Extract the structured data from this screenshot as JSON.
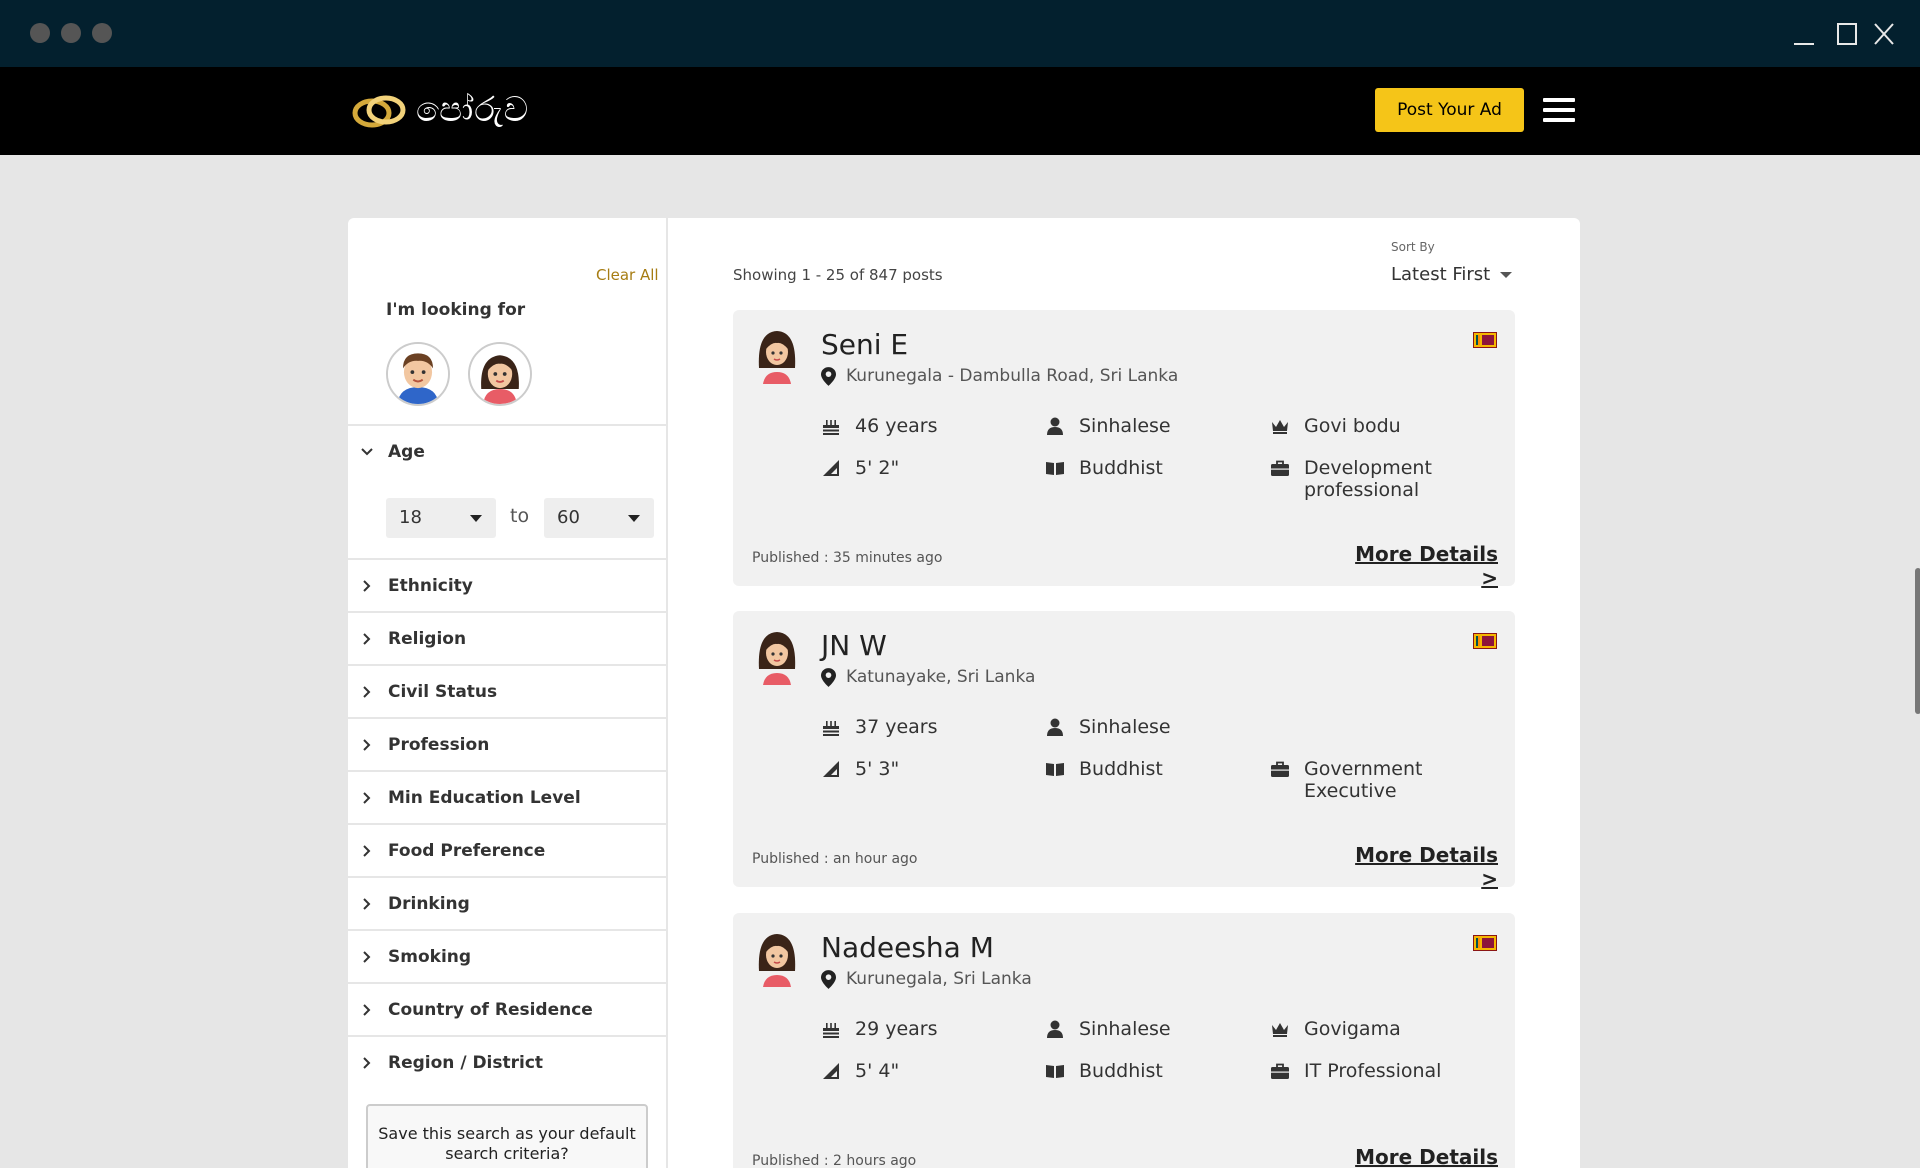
{
  "window": {
    "controls": [
      "minimize-icon",
      "maximize-icon",
      "close-icon"
    ]
  },
  "header": {
    "logo_text": "පෝරුව",
    "post_button": "Post Your Ad",
    "accent": "#f5c518"
  },
  "sidebar": {
    "clear_all": "Clear All",
    "looking_for": "I'm looking for",
    "age": {
      "label": "Age",
      "from": "18",
      "to_word": "to",
      "to": "60"
    },
    "filters": [
      "Ethnicity",
      "Religion",
      "Civil Status",
      "Profession",
      "Min Education Level",
      "Food Preference",
      "Drinking",
      "Smoking",
      "Country of Residence",
      "Region / District"
    ],
    "save_search": "Save this search as your default search criteria?"
  },
  "results": {
    "showing": "Showing 1 - 25 of 847 posts",
    "sort_by_label": "Sort By",
    "sort_value": "Latest First",
    "more_details": "More Details >",
    "posts": [
      {
        "name": "Seni E",
        "location": "Kurunegala - Dambulla Road, Sri Lanka",
        "age": "46 years",
        "height": "5' 2\"",
        "ethnicity": "Sinhalese",
        "religion": "Buddhist",
        "caste": "Govi bodu",
        "profession": "Development professional",
        "published": "Published : 35 minutes ago"
      },
      {
        "name": "JN W",
        "location": "Katunayake, Sri Lanka",
        "age": "37 years",
        "height": "5' 3\"",
        "ethnicity": "Sinhalese",
        "religion": "Buddhist",
        "caste": "",
        "profession": "Government Executive",
        "published": "Published : an hour ago"
      },
      {
        "name": "Nadeesha M",
        "location": "Kurunegala, Sri Lanka",
        "age": "29 years",
        "height": "5' 4\"",
        "ethnicity": "Sinhalese",
        "religion": "Buddhist",
        "caste": "Govigama",
        "profession": "IT Professional",
        "published": "Published : 2 hours ago"
      }
    ]
  }
}
